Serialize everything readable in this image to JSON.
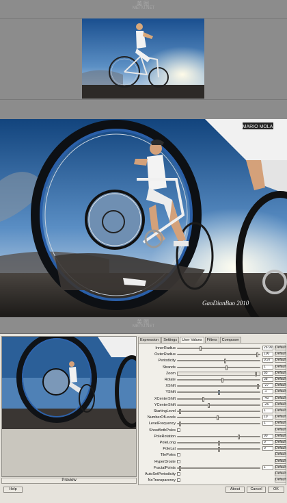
{
  "watermark": {
    "top": "美图",
    "bottom": "MEITU.NET"
  },
  "photo": {
    "signature": "GaoDianBao 2010"
  },
  "dialog": {
    "tabs": [
      "Expression",
      "Settings",
      "User Values",
      "Filters",
      "Composer"
    ],
    "active_tab": "User Values",
    "preview_label": "Preview",
    "params": [
      {
        "label": "InnerRadius",
        "kind": "slider",
        "value": "26.99",
        "pos": 0.27
      },
      {
        "label": "OuterRadius",
        "kind": "slider",
        "value": "100",
        "pos": 0.98
      },
      {
        "label": "Periodicity",
        "kind": "slider",
        "value": "0.97",
        "pos": 0.58
      },
      {
        "label": "Strands",
        "kind": "slider",
        "value": "1",
        "pos": 0.6
      },
      {
        "label": "Zoom",
        "kind": "bigbar",
        "value": "85",
        "pos": 0.97
      },
      {
        "label": "Rotate",
        "kind": "slider",
        "value": "38",
        "pos": 0.55
      },
      {
        "label": "XShift",
        "kind": "slider",
        "value": "-27",
        "pos": 0.99
      },
      {
        "label": "YShift",
        "kind": "slider",
        "value": "-1",
        "pos": 0.5,
        "focused": true
      },
      {
        "label": "XCenterShift",
        "kind": "slider",
        "value": "-40",
        "pos": 0.31
      },
      {
        "label": "YCenterShift",
        "kind": "slider",
        "value": "-26",
        "pos": 0.38
      },
      {
        "label": "StartingLevel",
        "kind": "slider",
        "value": "1",
        "pos": 0.02
      },
      {
        "label": "NumberOfLevels",
        "kind": "slider",
        "value": "10",
        "pos": 0.49
      },
      {
        "label": "LevelFrequency",
        "kind": "slider",
        "value": "1",
        "pos": 0.02
      },
      {
        "label": "ShowBothPoles",
        "kind": "check"
      },
      {
        "label": "PoleRotation",
        "kind": "slider",
        "value": "90",
        "pos": 0.75
      },
      {
        "label": "PoleLong",
        "kind": "slider",
        "value": "0",
        "pos": 0.5
      },
      {
        "label": "PoleLat",
        "kind": "slider",
        "value": "0",
        "pos": 0.5
      },
      {
        "label": "TilePoles",
        "kind": "check"
      },
      {
        "label": "HyperDroste",
        "kind": "check"
      },
      {
        "label": "FractalPoints",
        "kind": "slider",
        "value": "1",
        "pos": 0.02
      },
      {
        "label": "AutoSetPeriodicity",
        "kind": "check"
      },
      {
        "label": "NoTransparency",
        "kind": "check"
      }
    ],
    "default_label": "Default",
    "help_label": "Help",
    "about_label": "About",
    "cancel_label": "Cancel",
    "ok_label": "OK"
  }
}
